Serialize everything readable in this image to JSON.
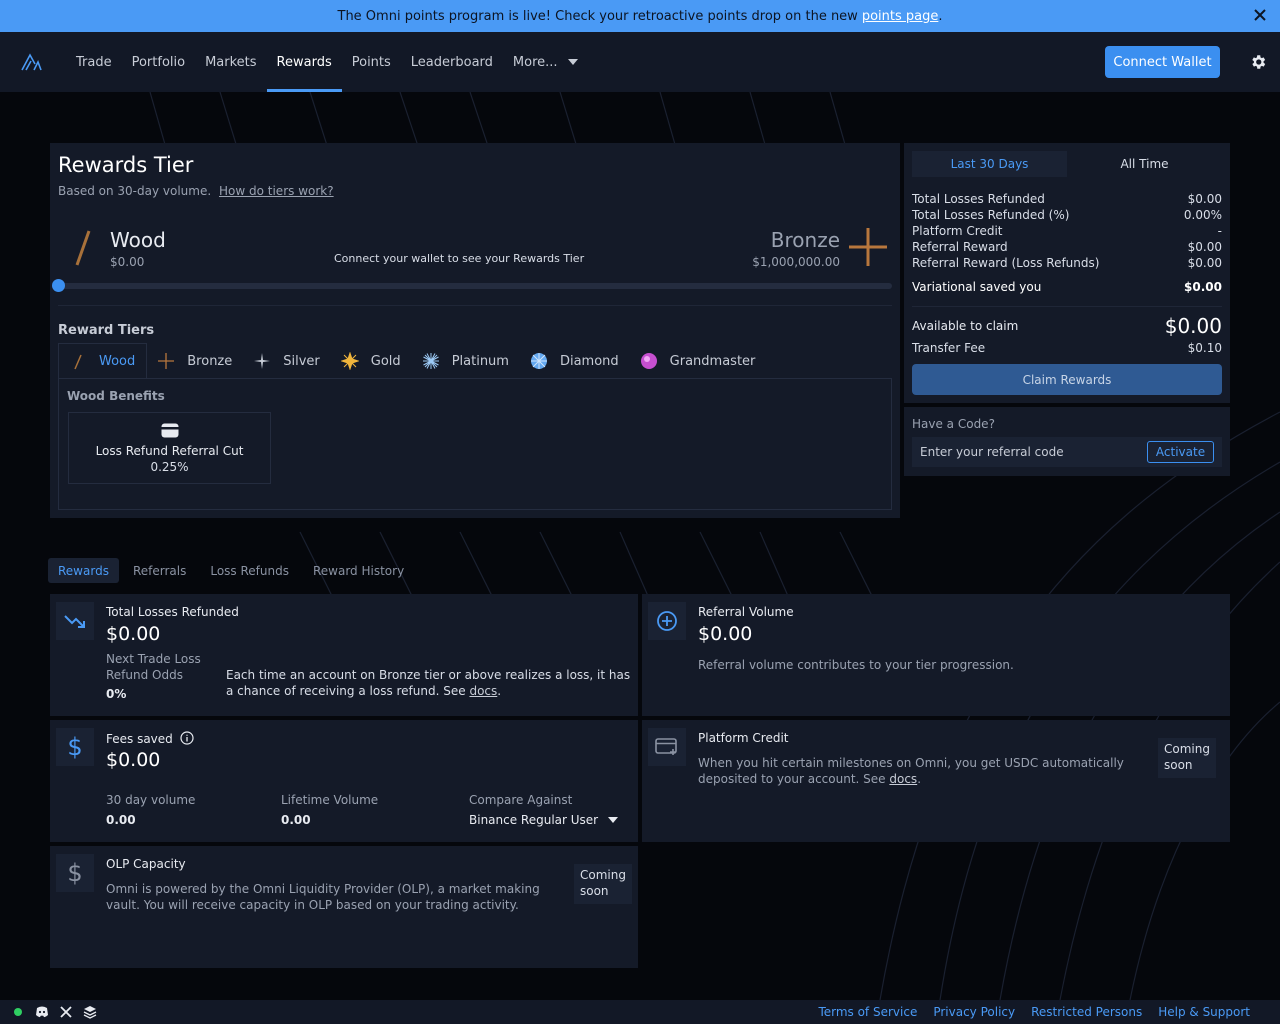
{
  "banner": {
    "text": "The Omni points program is live! Check your retroactive points drop on the new",
    "link": "points page",
    "suffix": "."
  },
  "nav": {
    "links": [
      "Trade",
      "Portfolio",
      "Markets",
      "Rewards",
      "Points",
      "Leaderboard",
      "More..."
    ],
    "active": "Rewards",
    "connect": "Connect Wallet"
  },
  "tier": {
    "title": "Rewards Tier",
    "subtitle": "Based on 30-day volume.",
    "subtitle_link": "How do tiers work?",
    "current": {
      "name": "Wood",
      "amount": "$0.00"
    },
    "message": "Connect your wallet to see your Rewards Tier",
    "next": {
      "name": "Bronze",
      "amount": "$1,000,000.00"
    },
    "progress": 0,
    "tiers_title": "Reward Tiers",
    "tiers": [
      {
        "label": "Wood",
        "color": "#a8713a"
      },
      {
        "label": "Bronze",
        "color": "#b8773d"
      },
      {
        "label": "Silver",
        "color": "#c8ced8"
      },
      {
        "label": "Gold",
        "color": "#f0b53c"
      },
      {
        "label": "Platinum",
        "color": "#9cc9f5"
      },
      {
        "label": "Diamond",
        "color": "#64a8f0"
      },
      {
        "label": "Grandmaster",
        "color": "#c64fd0"
      }
    ],
    "benefits_title": "Wood Benefits",
    "benefit": {
      "label": "Loss Refund Referral Cut",
      "value": "0.25%",
      "icon": "card-icon"
    }
  },
  "side": {
    "periods": [
      "Last 30 Days",
      "All Time"
    ],
    "stats": [
      {
        "label": "Total Losses Refunded",
        "value": "$0.00"
      },
      {
        "label": "Total Losses Refunded (%)",
        "value": "0.00%"
      },
      {
        "label": "Platform Credit",
        "value": "-"
      },
      {
        "label": "Referral Reward",
        "value": "$0.00"
      },
      {
        "label": "Referral Reward (Loss Refunds)",
        "value": "$0.00"
      }
    ],
    "saved": {
      "label": "Variational saved you",
      "value": "$0.00"
    },
    "available": {
      "label": "Available to claim",
      "value": "$0.00"
    },
    "fee": {
      "label": "Transfer Fee",
      "value": "$0.10"
    },
    "claim": "Claim Rewards"
  },
  "code": {
    "title": "Have a Code?",
    "placeholder": "Enter your referral code",
    "activate": "Activate"
  },
  "section_tabs": [
    "Rewards",
    "Referrals",
    "Loss Refunds",
    "Reward History"
  ],
  "cards": {
    "losses": {
      "title": "Total Losses Refunded",
      "value": "$0.00",
      "odds_label": "Next Trade Loss Refund Odds",
      "odds_value": "0%",
      "text": "Each time an account on Bronze tier or above realizes a loss, it has a chance of receiving a loss refund. See",
      "link": "docs",
      "suffix": "."
    },
    "referral": {
      "title": "Referral Volume",
      "value": "$0.00",
      "text": "Referral volume contributes to your tier progression."
    },
    "fees": {
      "title": "Fees saved",
      "value": "$0.00",
      "vol30_label": "30 day volume",
      "vol30_value": "0.00",
      "life_label": "Lifetime Volume",
      "life_value": "0.00",
      "compare_label": "Compare Against",
      "compare_value": "Binance Regular User"
    },
    "credit": {
      "title": "Platform Credit",
      "text": "When you hit certain milestones on Omni, you get USDC automatically deposited to your account. See",
      "link": "docs",
      "suffix": ".",
      "badge": "Coming soon"
    },
    "olp": {
      "title": "OLP Capacity",
      "text": "Omni is powered by the Omni Liquidity Provider (OLP), a market making vault. You will receive capacity in OLP based on your trading activity.",
      "badge": "Coming soon"
    }
  },
  "footer": {
    "links": [
      "Terms of Service",
      "Privacy Policy",
      "Restricted Persons",
      "Help & Support"
    ]
  },
  "colors": {
    "accent": "#4a9af5",
    "panel": "#141a28",
    "background": "#05070c"
  }
}
